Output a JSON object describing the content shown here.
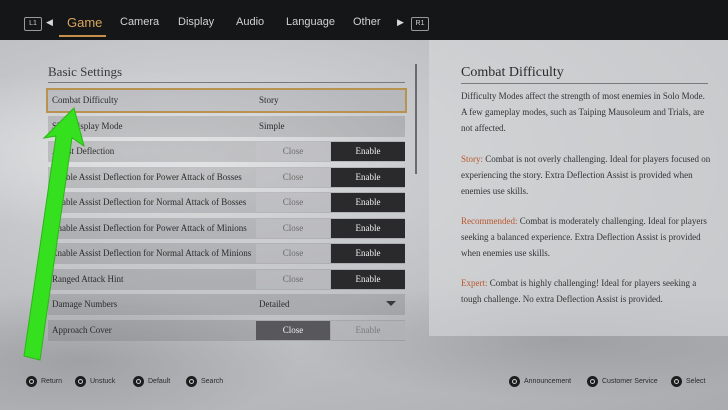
{
  "tabs": {
    "left_badge": "L1",
    "right_badge": "R1",
    "items": [
      "Game",
      "Camera",
      "Display",
      "Audio",
      "Language",
      "Other"
    ],
    "active": "Game"
  },
  "left": {
    "section_title": "Basic Settings",
    "rows": [
      {
        "label": "Combat Difficulty",
        "value": "Story"
      },
      {
        "label": "Skill Display Mode",
        "value": "Simple"
      },
      {
        "label": "Assist Deflection",
        "close": "Close",
        "enable": "Enable"
      },
      {
        "label": "Enable Assist Deflection for Power Attack of Bosses",
        "close": "Close",
        "enable": "Enable"
      },
      {
        "label": "Enable Assist Deflection for Normal Attack of Bosses",
        "close": "Close",
        "enable": "Enable"
      },
      {
        "label": "Enable Assist Deflection for Power Attack of Minions",
        "close": "Close",
        "enable": "Enable"
      },
      {
        "label": "Enable Assist Deflection for Normal Attack of Minions",
        "close": "Close",
        "enable": "Enable"
      },
      {
        "label": "Ranged Attack Hint",
        "close": "Close",
        "enable": "Enable"
      },
      {
        "label": "Damage Numbers",
        "value": "Detailed"
      },
      {
        "label": "Approach Cover",
        "close": "Close",
        "enable": "Enable"
      }
    ]
  },
  "right": {
    "title": "Combat Difficulty",
    "intro": "Difficulty Modes affect the strength of most enemies in Solo Mode. A few gameplay modes, such as Taiping Mausoleum and Trials, are not affected.",
    "story_key": "Story:",
    "story_text": " Combat is not overly challenging. Ideal for players focused on experiencing the story. Extra Deflection Assist is provided when enemies use skills.",
    "rec_key": "Recommended:",
    "rec_text": " Combat is moderately challenging. Ideal for players seeking a balanced experience. Extra Deflection Assist is provided when enemies use skills.",
    "expert_key": "Expert:",
    "expert_text": " Combat is highly challenging! Ideal for players seeking a tough challenge. No extra Deflection Assist is provided."
  },
  "hints": {
    "return": "Return",
    "unstuck": "Unstuck",
    "default": "Default",
    "search": "Search",
    "announcement": "Announcement",
    "customer_service": "Customer Service",
    "select": "Select"
  },
  "colors": {
    "accent": "#d9a35c",
    "highlight_key": "#b9582e",
    "annotation_arrow": "#35e01e"
  }
}
